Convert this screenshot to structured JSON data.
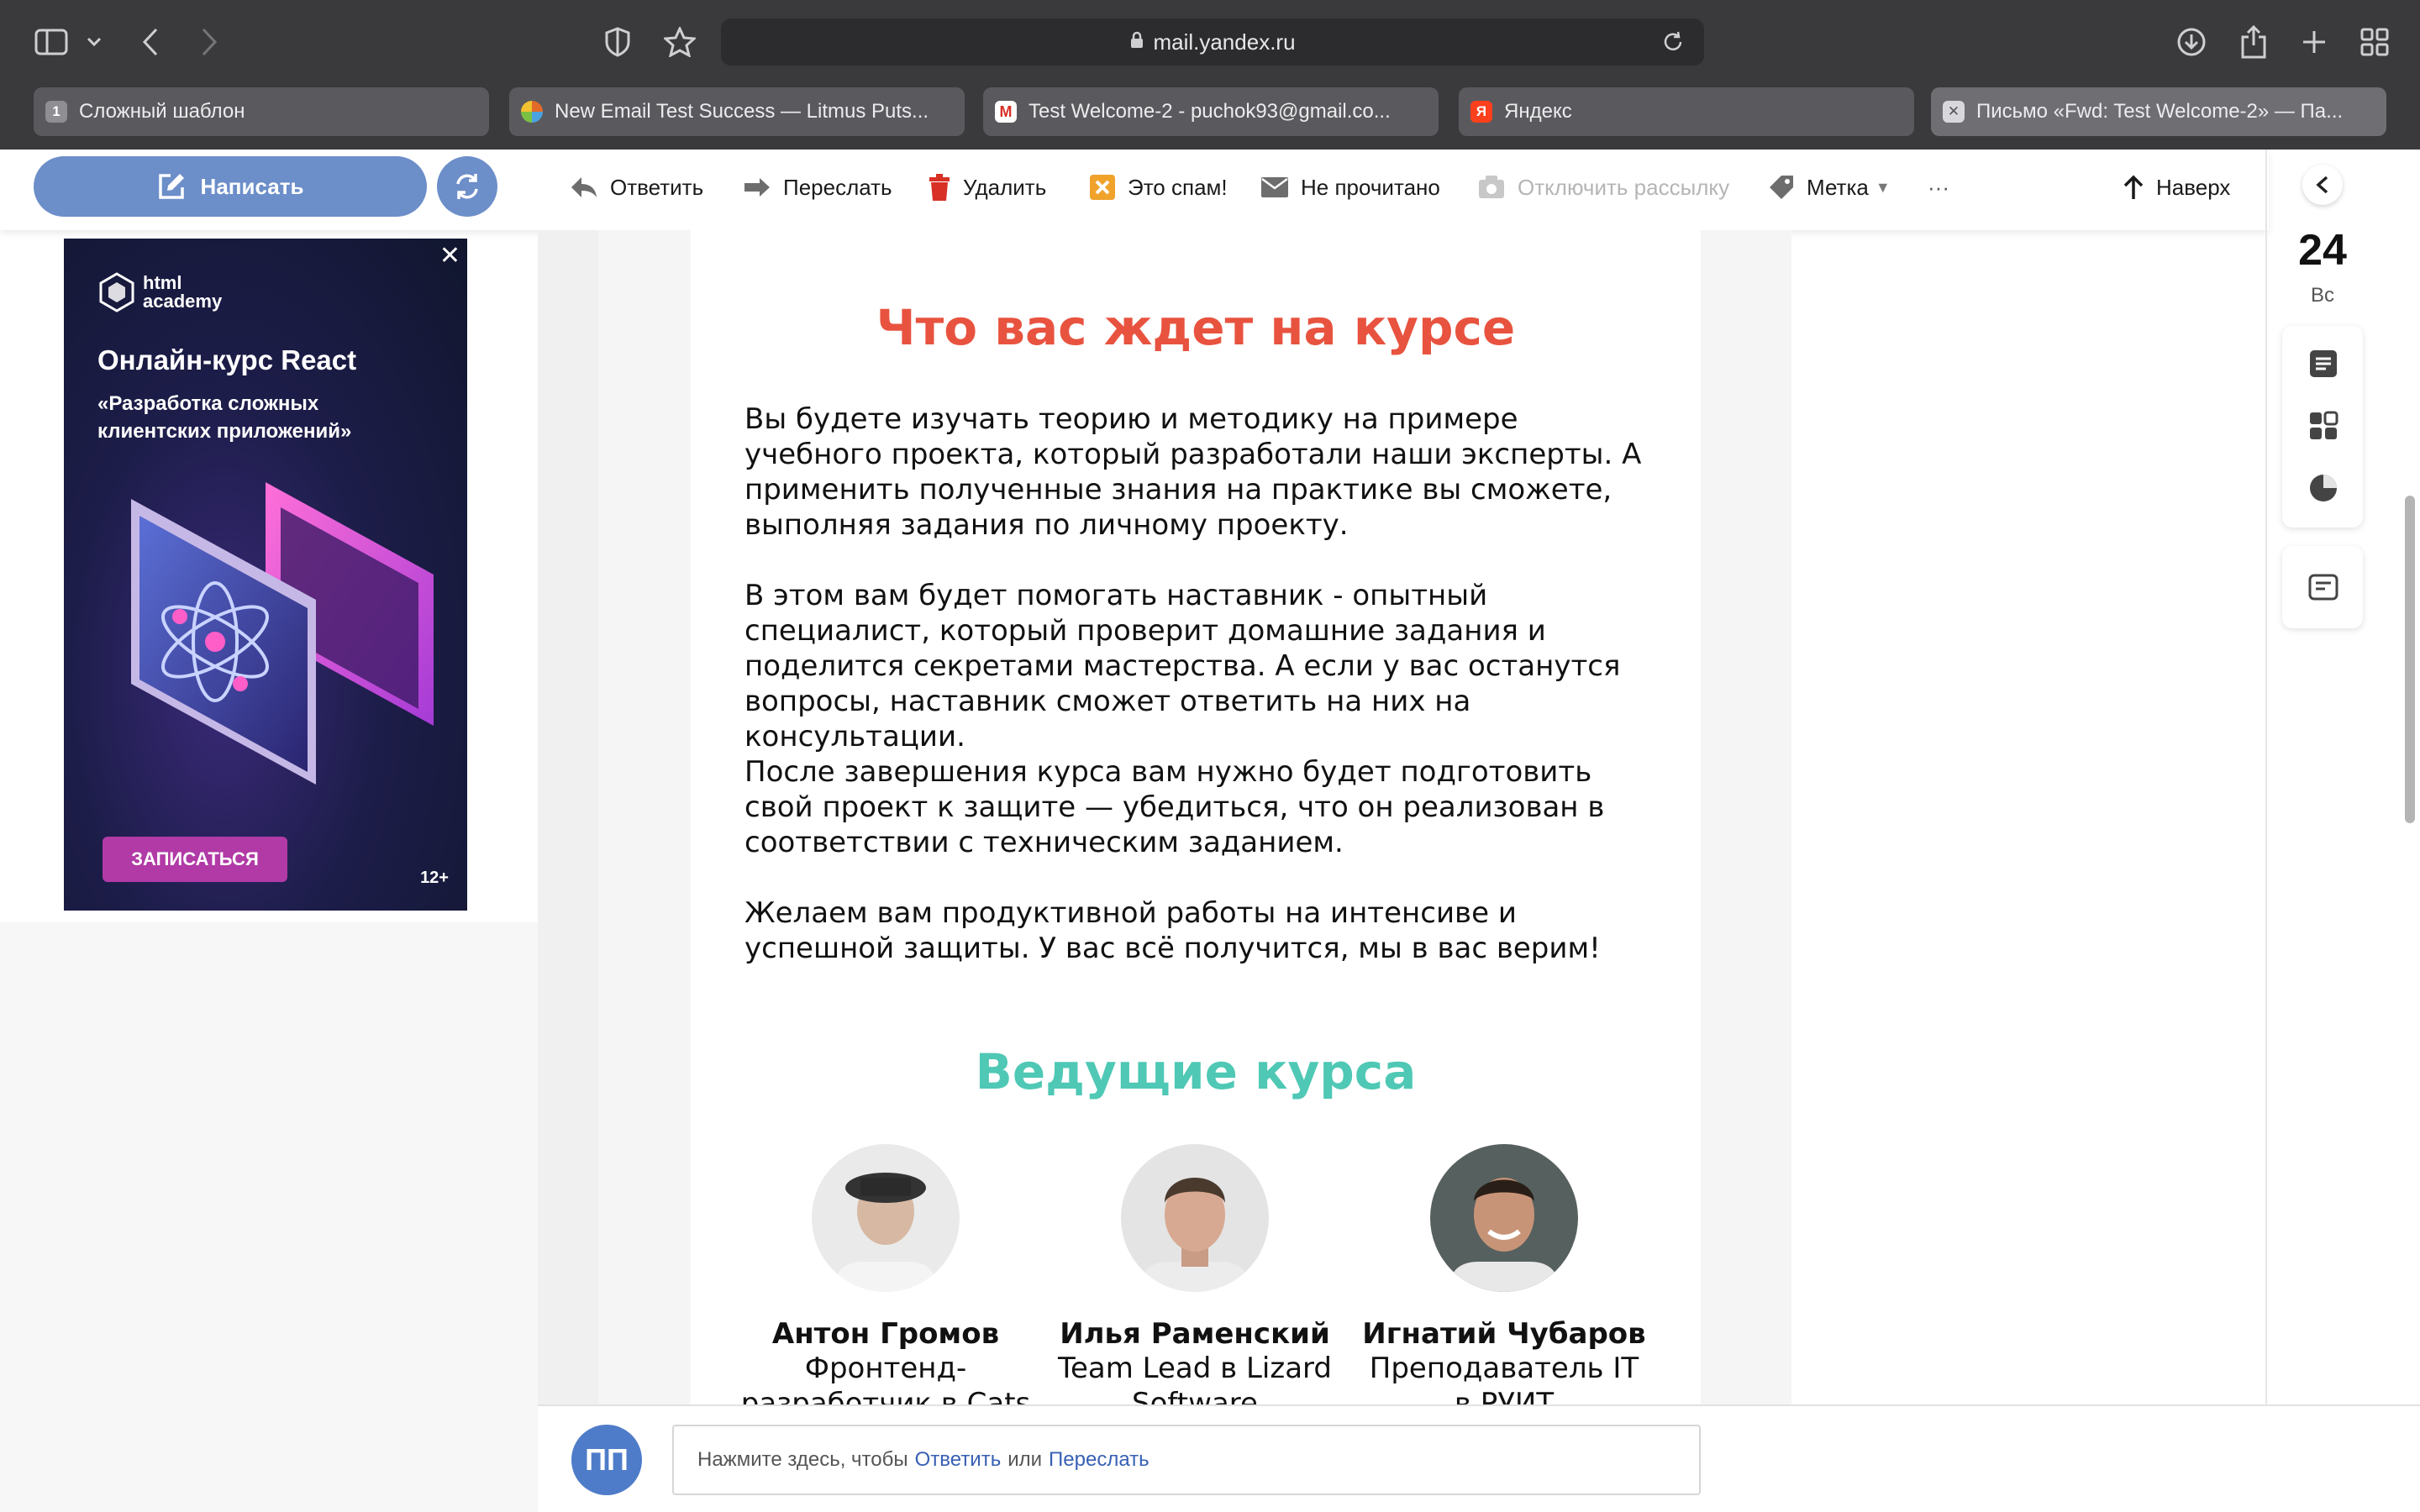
{
  "browser": {
    "url": "mail.yandex.ru",
    "tabs": [
      {
        "label": "Сложный шаблон",
        "favicon": "1"
      },
      {
        "label": "New Email Test Success — Litmus Puts...",
        "favicon": "litmus-icon"
      },
      {
        "label": "Test Welcome-2 - puchok93@gmail.co...",
        "favicon": "gmail-icon"
      },
      {
        "label": "Яндекс",
        "favicon": "Я"
      },
      {
        "label": "Письмо «Fwd: Test Welcome-2» — Па...",
        "favicon": "close-icon"
      }
    ]
  },
  "mail_toolbar": {
    "compose_label": "Написать",
    "reply_label": "Ответить",
    "forward_label": "Переслать",
    "delete_label": "Удалить",
    "spam_label": "Это спам!",
    "unread_label": "Не прочитано",
    "unsubscribe_label": "Отключить рассылку",
    "label_label": "Метка",
    "more_label": "···",
    "top_label": "Наверх"
  },
  "ad": {
    "logo_line1": "html",
    "logo_line2": "academy",
    "title": "Онлайн-курс React",
    "subtitle": "«Разработка сложных клиентских приложений»",
    "cta": "ЗАПИСАТЬСЯ",
    "age": "12+",
    "close": "✕"
  },
  "email": {
    "heading_1": "Что вас ждет на курсе",
    "paragraphs": [
      "Вы будете изучать теорию и методику на примере учебного проекта, который разработали наши эксперты. А применить полученные знания на практике вы сможете, выполняя задания по личному проекту.",
      "В этом вам будет помогать наставник - опытный специалист, который проверит домашние задания и поделится секретами мастерства. А если у вас останутся вопросы, наставник сможет ответить на них на консультации.",
      "После завершения курса вам нужно будет подготовить свой проект к защите — убедиться, что он реализован в соответствии с техническим заданием.",
      "Желаем вам продуктивной работы на интенсиве и успешной защиты. У вас всё получится, мы в вас верим!"
    ],
    "heading_2": "Ведущие курса",
    "instructors": [
      {
        "name": "Антон Громов",
        "role_line1": "Фронтенд-",
        "role_line2": "разработчик в Cats"
      },
      {
        "name": "Илья Раменский",
        "role_line1": "Team Lead в Lizard",
        "role_line2": "Software"
      },
      {
        "name": "Игнатий Чубаров",
        "role_line1": "Преподаватель IT",
        "role_line2": "в РУИТ"
      }
    ]
  },
  "right_sidebar": {
    "date": "24",
    "weekday": "Вс"
  },
  "quick_reply": {
    "avatar_initials": "ПП",
    "text_before": "Нажмите здесь, чтобы",
    "reply_link": "Ответить",
    "text_middle": "или",
    "forward_link": "Переслать"
  },
  "colors": {
    "heading_orange": "#e8533f",
    "heading_teal": "#4fc8b5",
    "compose_blue": "#6c8ec9",
    "link_blue": "#3860b4"
  }
}
